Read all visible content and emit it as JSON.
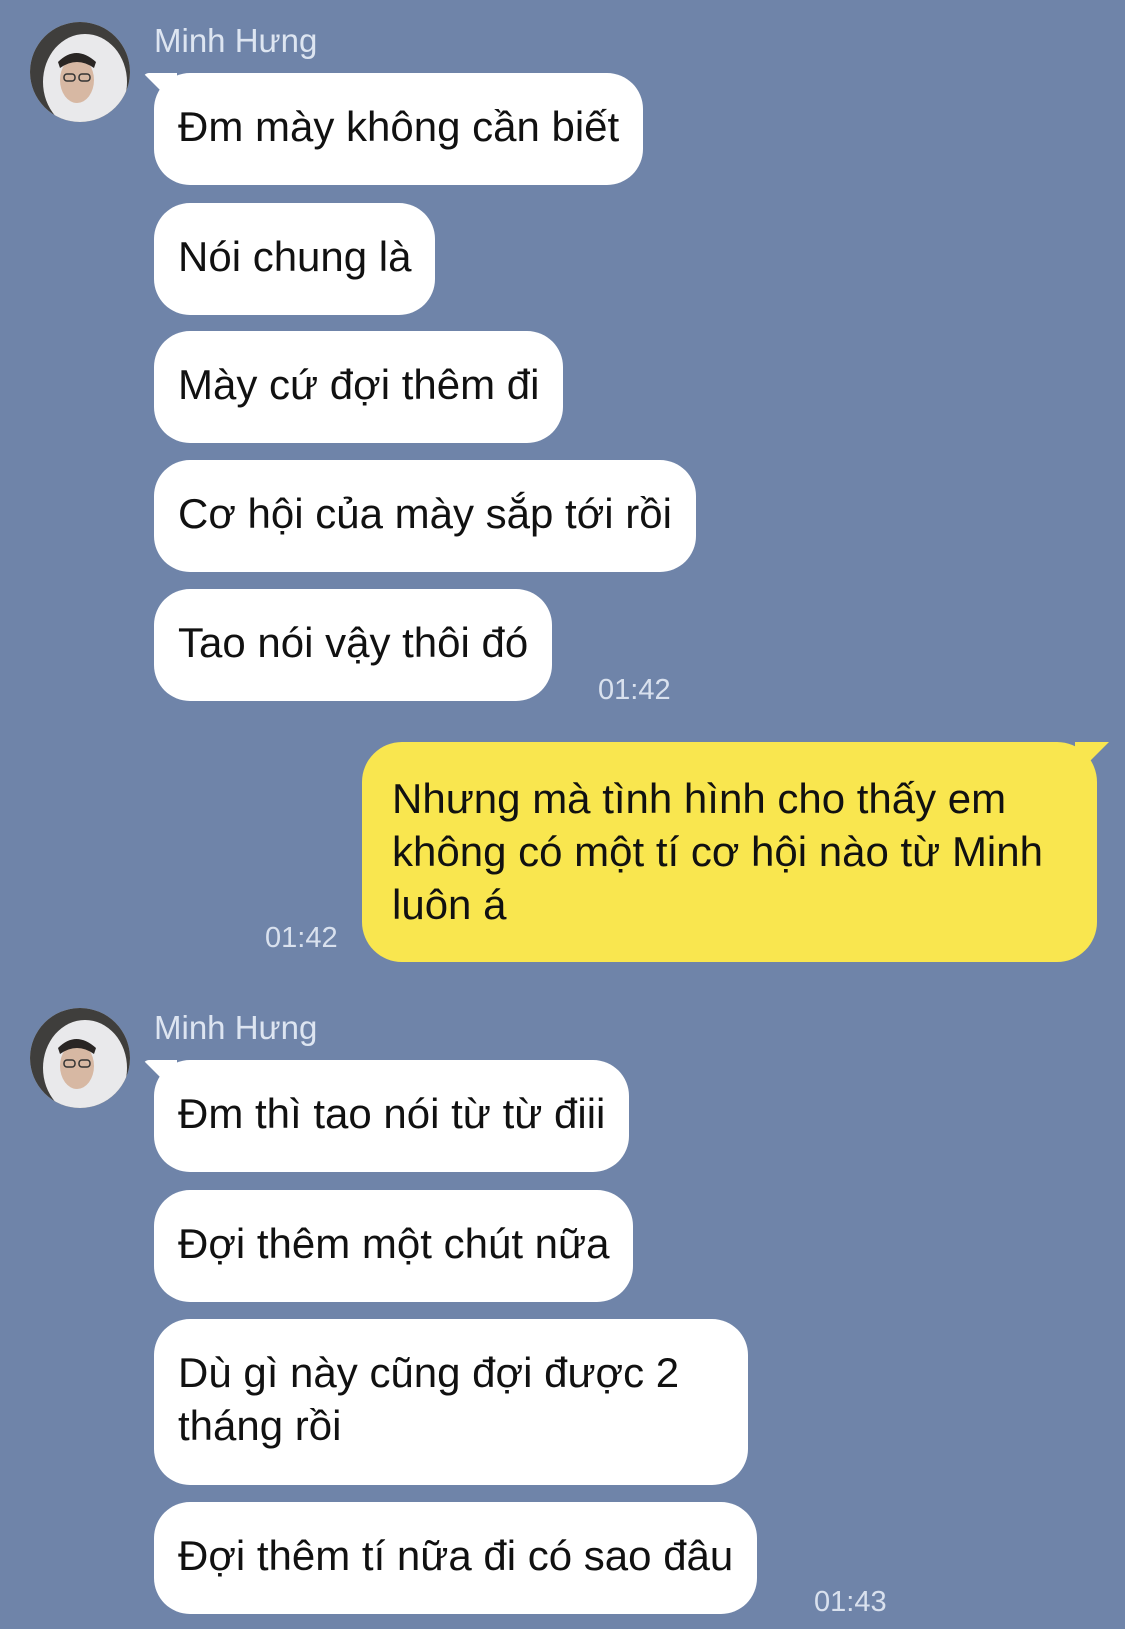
{
  "groups": [
    {
      "sender": "Minh Hưng",
      "messages": [
        "Đm mày không cần biết",
        "Nói chung là",
        "Mày cứ đợi thêm đi",
        "Cơ hội của mày sắp tới rồi",
        "Tao nói vậy thôi đó"
      ],
      "time": "01:42"
    },
    {
      "outgoing": {
        "message": "Nhưng mà tình hình cho thấy em không có một tí cơ hội nào từ Minh luôn á",
        "time": "01:42"
      }
    },
    {
      "sender": "Minh Hưng",
      "messages": [
        "Đm thì tao nói từ từ điii",
        "Đợi thêm một chút nữa",
        "Dù gì này cũng đợi được 2 tháng rồi",
        "Đợi thêm tí nữa đi có sao đâu"
      ],
      "time": "01:43"
    }
  ],
  "colors": {
    "background": "#6f84a9",
    "incoming_bubble": "#ffffff",
    "outgoing_bubble": "#f9e64f"
  }
}
